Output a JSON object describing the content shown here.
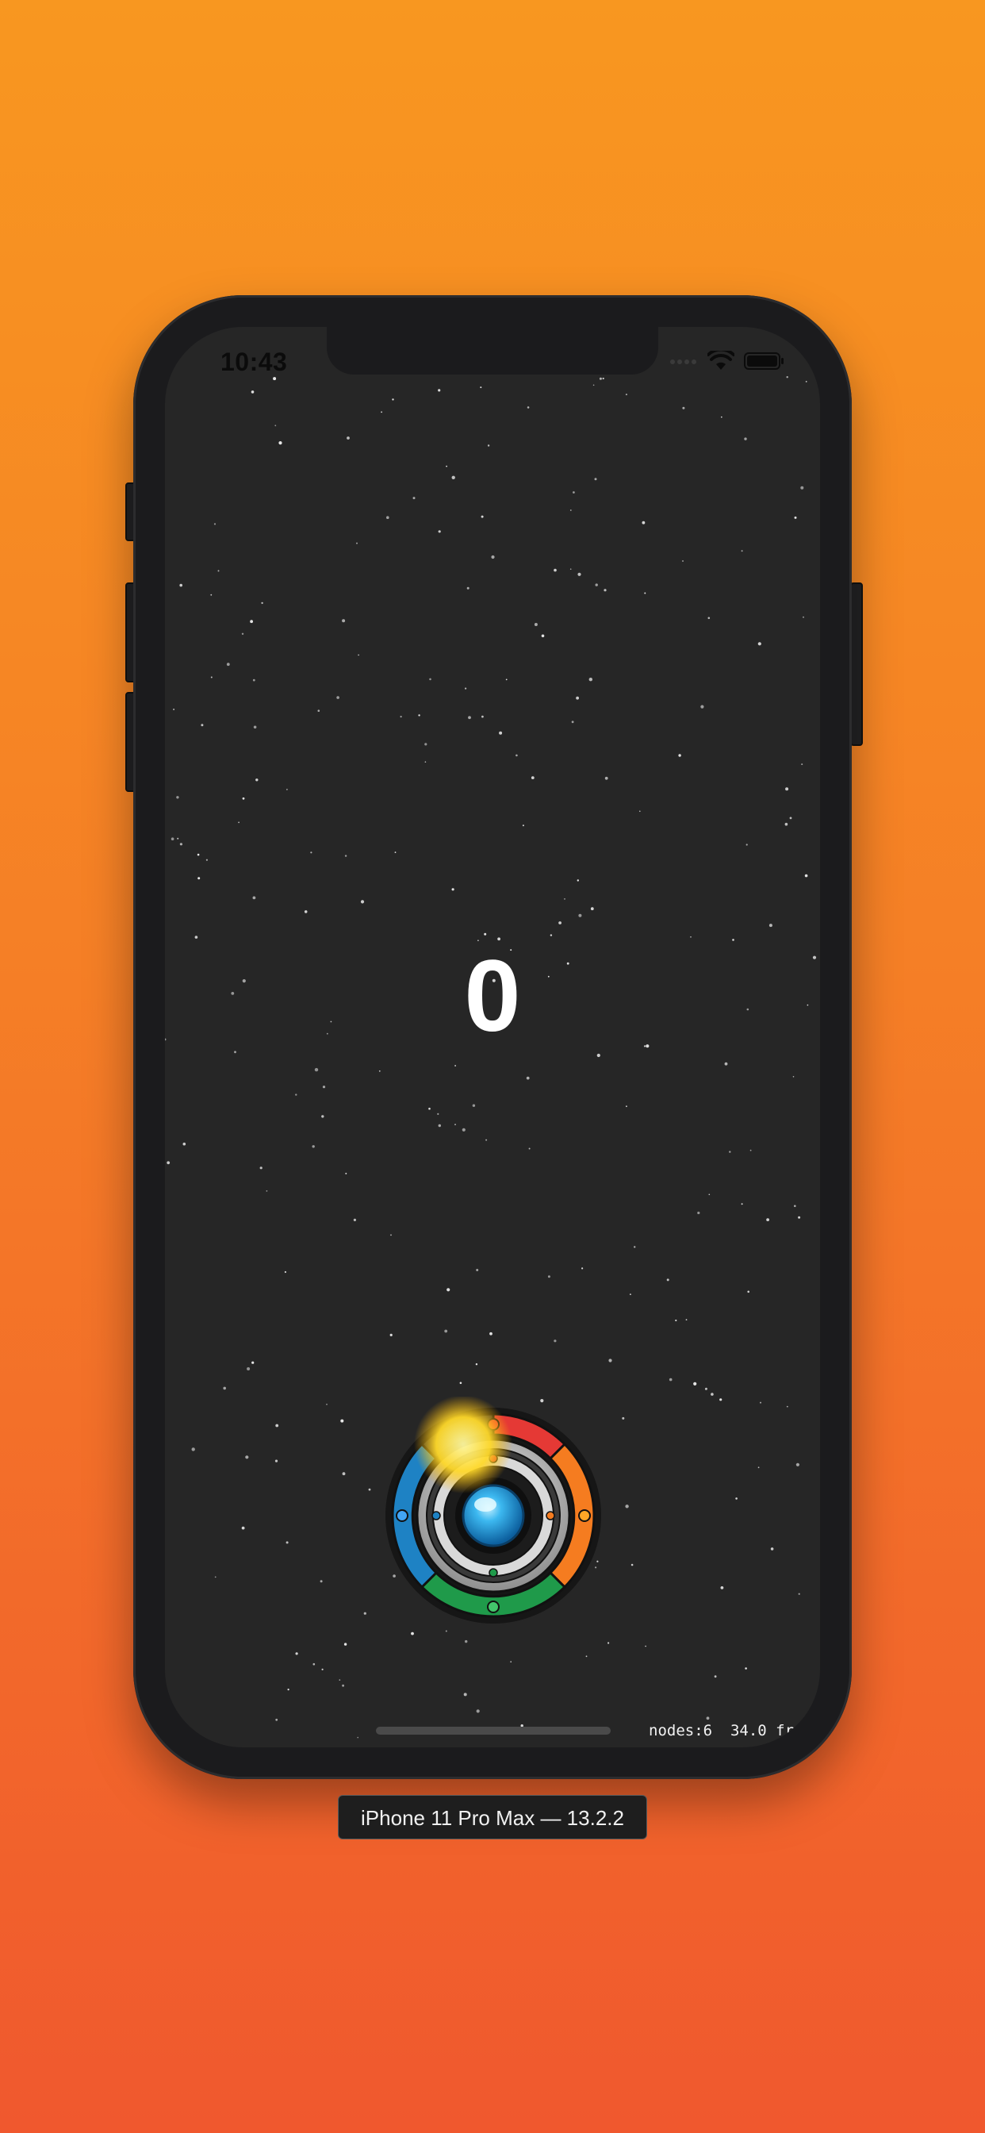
{
  "status_bar": {
    "time": "10:43",
    "signal_icon": "signal-dots-icon",
    "wifi_icon": "wifi-icon",
    "battery_icon": "battery-icon"
  },
  "game": {
    "score": "0",
    "player_icon": "ship-icon",
    "sun_icon": "sun-glow-icon",
    "ring_colors": {
      "red": "#e53935",
      "orange": "#f57c20",
      "green": "#1f9a4a",
      "blue": "#1e82c4",
      "core": "#29a8e8"
    }
  },
  "debug": {
    "nodes": "nodes:6",
    "fps": "34.0 fr"
  },
  "device": {
    "label": "iPhone 11 Pro Max — 13.2.2"
  },
  "colors": {
    "background_top": "#f89720",
    "background_bottom": "#f0582e",
    "screen": "#262626"
  }
}
